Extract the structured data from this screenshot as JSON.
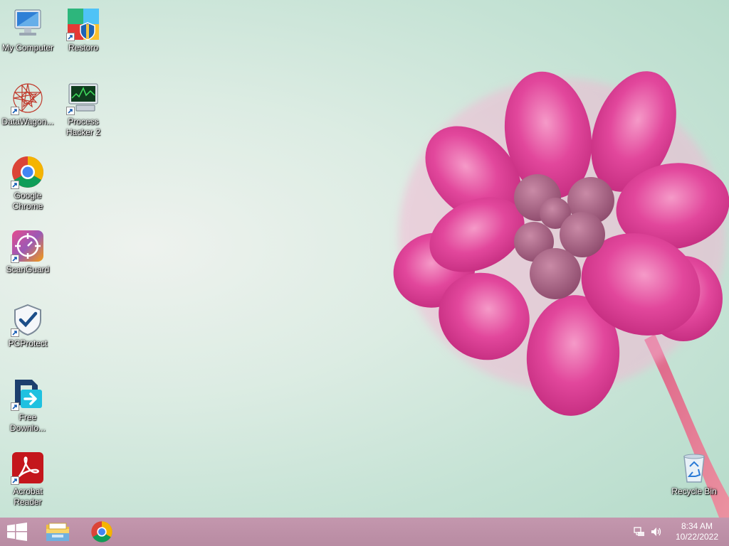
{
  "desktop": {
    "icons": [
      {
        "label": "My Computer",
        "icon": "computer-icon"
      },
      {
        "label": "Restoro",
        "icon": "restoro-icon"
      },
      {
        "label": "DataWagon...",
        "icon": "datawagon-icon"
      },
      {
        "label": "Process Hacker 2",
        "icon": "process-hacker-icon"
      },
      {
        "label": "Google Chrome",
        "icon": "chrome-icon"
      },
      {
        "label": "ScanGuard",
        "icon": "scanguard-icon"
      },
      {
        "label": "PCProtect",
        "icon": "pcprotect-icon"
      },
      {
        "label": "Free Downlo...",
        "icon": "free-downloader-icon"
      },
      {
        "label": "Acrobat Reader",
        "icon": "acrobat-icon"
      },
      {
        "label": "Recycle Bin",
        "icon": "recycle-bin-icon"
      }
    ]
  },
  "taskbar": {
    "start": "windows-start-icon",
    "pinned": [
      "file-explorer-icon",
      "chrome-icon"
    ],
    "tray": {
      "network": "network-icon",
      "volume": "volume-icon",
      "time": "8:34 AM",
      "date": "10/22/2022"
    }
  },
  "colors": {
    "taskbar": "#be91a8",
    "wallpaper_bg": "#c8e4d6",
    "flower": "#e0449a"
  }
}
